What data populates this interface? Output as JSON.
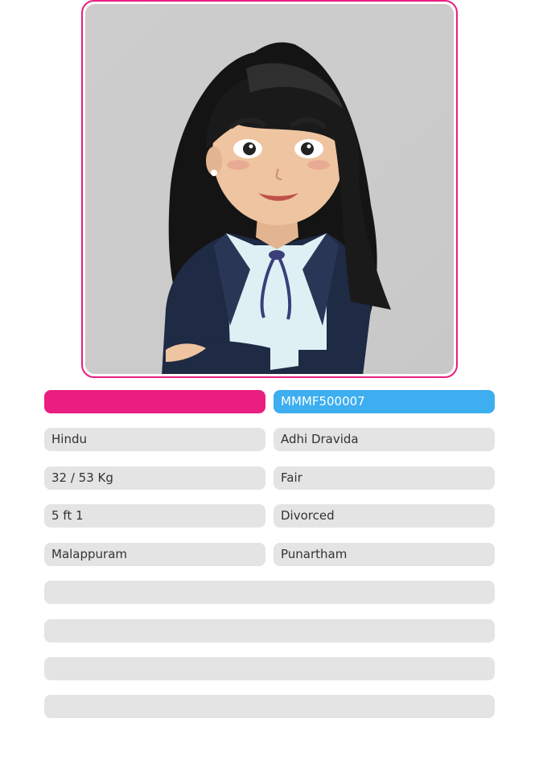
{
  "profile": {
    "name": "",
    "profile_id": "MMMF500007",
    "religion": "Hindu",
    "caste": "Adhi Dravida",
    "age_weight": "32 / 53 Kg",
    "complexion": "Fair",
    "height": "5 ft 1",
    "marital_status": "Divorced",
    "location": "Malappuram",
    "star": "Punartham"
  },
  "colors": {
    "accent_pink": "#e91e80",
    "accent_blue": "#3daef0",
    "field_bg": "#e4e4e4"
  },
  "avatar": {
    "icon": "female-avatar-illustration"
  }
}
